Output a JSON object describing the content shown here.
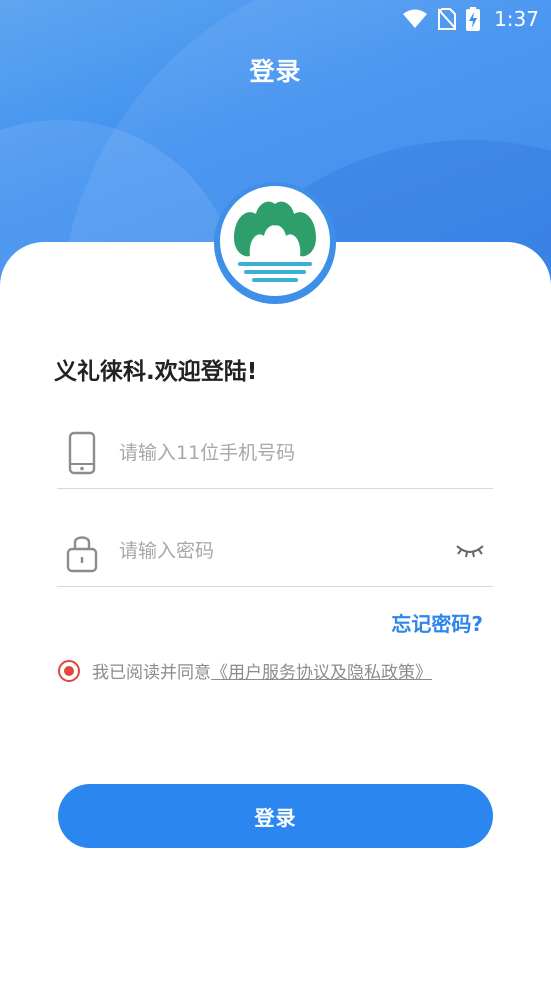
{
  "status_bar": {
    "time": "1:37",
    "icons": [
      "wifi-icon",
      "no-sim-icon",
      "battery-charging-icon"
    ]
  },
  "header": {
    "title": "登录"
  },
  "logo": {
    "icon": "app-logo-icon"
  },
  "welcome_text": "义礼徕科.欢迎登陆!",
  "phone_field": {
    "placeholder": "请输入11位手机号码",
    "value": "",
    "icon": "phone-icon"
  },
  "password_field": {
    "placeholder": "请输入密码",
    "value": "",
    "icon": "lock-icon",
    "toggle_icon": "eye-closed-icon"
  },
  "forgot_password": "忘记密码?",
  "agreement": {
    "prefix": "我已阅读并同意",
    "link": "《用户服务协议及隐私政策》",
    "checked": true
  },
  "login_button": "登录",
  "colors": {
    "primary": "#2b86ef",
    "header_gradient_start": "#5fa6f0",
    "header_gradient_end": "#2f7fe8",
    "radio": "#e0473e",
    "logo_green": "#2e9f6b"
  }
}
